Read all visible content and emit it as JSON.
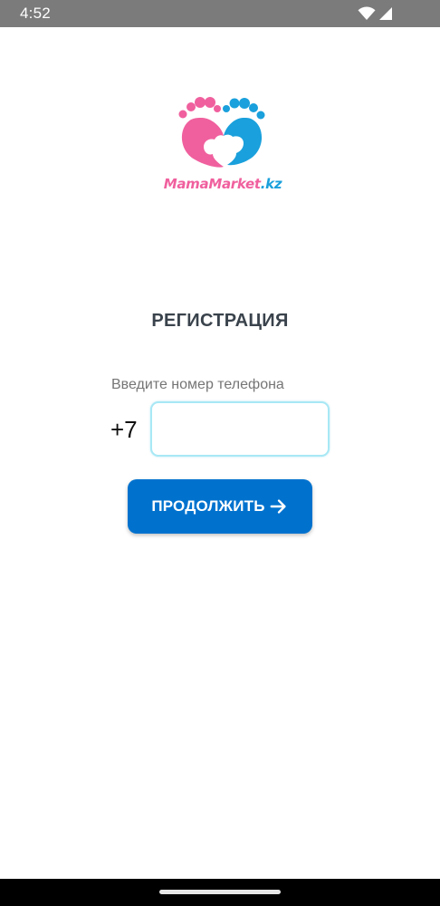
{
  "status_bar": {
    "time": "4:52",
    "icons": [
      "wifi-icon",
      "cellular-signal-icon"
    ]
  },
  "logo": {
    "brand_part_a": "MamaMarket",
    "brand_part_b": ".kz",
    "colors": {
      "pink": "#f0609e",
      "blue": "#1aa0dc"
    }
  },
  "registration": {
    "title": "РЕГИСТРАЦИЯ",
    "phone_label": "Введите номер телефона",
    "phone_prefix": "+7",
    "phone_value": "",
    "continue_label": "ПРОДОЛЖИТЬ",
    "continue_icon": "arrow-right-icon"
  },
  "theme": {
    "accent": "#0072ce",
    "input_border": "#a8e8f5",
    "title_color": "#3a434c",
    "label_color": "#757575"
  }
}
